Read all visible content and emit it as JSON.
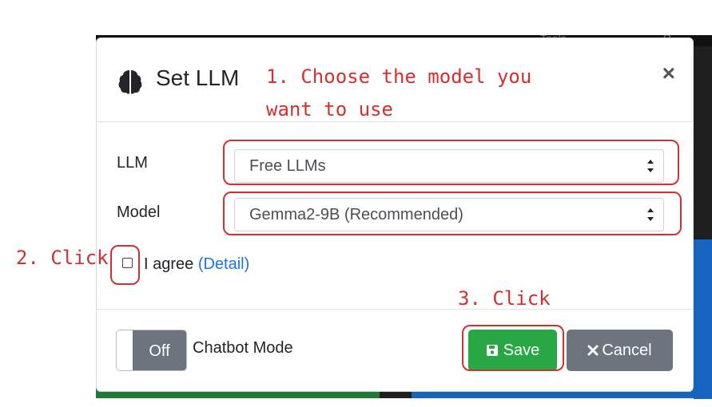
{
  "modal": {
    "title": "Set LLM",
    "close_label": "×",
    "fields": {
      "llm_label": "LLM",
      "llm_value": "Free LLMs",
      "model_label": "Model",
      "model_value": "Gemma2-9B (Recommended)"
    },
    "agree": {
      "text": "I agree",
      "link": "(Detail)"
    },
    "footer": {
      "toggle_state": "Off",
      "toggle_label": "Chatbot Mode",
      "save_label": "Save",
      "cancel_label": "Cancel"
    }
  },
  "annotations": {
    "step1_line1": "1. Choose the model you",
    "step1_line2": "want to use",
    "step2": "2. Click",
    "step3": "3. Click"
  },
  "background": {
    "topbar_left": "Tools",
    "topbar_right": "R"
  },
  "colors": {
    "annotation": "#d62f2f",
    "save": "#28a745",
    "cancel": "#6c757d",
    "link": "#1a73e8"
  },
  "icons": [
    "brain-icon",
    "close-icon",
    "chevron-updown-icon",
    "save-icon",
    "times-icon",
    "checkbox"
  ]
}
